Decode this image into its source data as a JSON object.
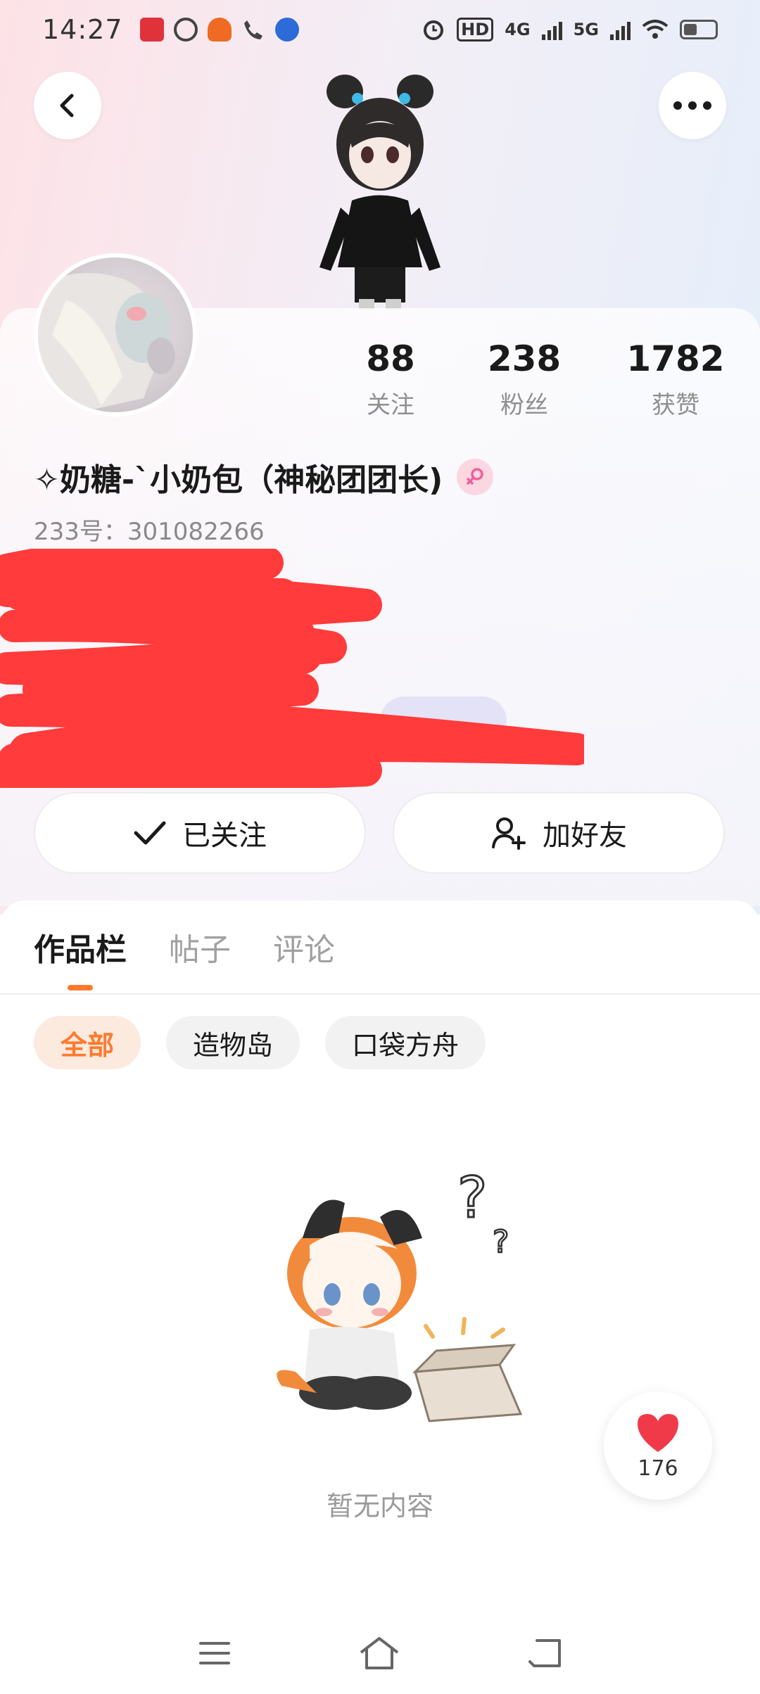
{
  "status_bar": {
    "time": "14:27",
    "notification_icons": [
      "news-icon",
      "link-icon",
      "game-icon",
      "missed-call-icon",
      "app-icon"
    ],
    "indicators": {
      "hd": "HD",
      "network_4g": "4G",
      "network_5g": "5G"
    }
  },
  "header": {
    "back_icon": "chevron-left-icon",
    "more_icon": "more-horizontal-icon"
  },
  "profile": {
    "stats": [
      {
        "value": "88",
        "label": "关注"
      },
      {
        "value": "238",
        "label": "粉丝"
      },
      {
        "value": "1782",
        "label": "获赞"
      }
    ],
    "nickname": "✧奶糖-`小奶包（神秘团团长)",
    "gender": "female",
    "uid_label": "233号：",
    "uid_value": "301082266"
  },
  "actions": {
    "follow_label": "已关注",
    "add_friend_label": "加好友"
  },
  "tabs": [
    {
      "label": "作品栏",
      "active": true
    },
    {
      "label": "帖子",
      "active": false
    },
    {
      "label": "评论",
      "active": false
    }
  ],
  "filters": [
    {
      "label": "全部",
      "active": true
    },
    {
      "label": "造物岛",
      "active": false
    },
    {
      "label": "口袋方舟",
      "active": false
    }
  ],
  "empty_state": {
    "text": "暂无内容"
  },
  "like_float": {
    "count": "176"
  },
  "colors": {
    "accent": "#ff7a2f",
    "heart": "#f03a4a",
    "scribble": "#ff3b3b"
  }
}
